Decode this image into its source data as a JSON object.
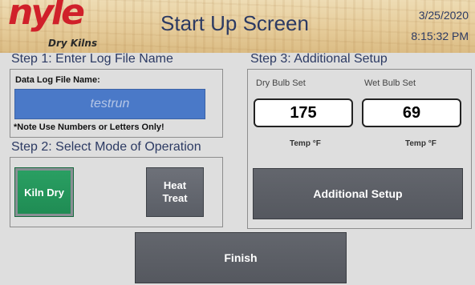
{
  "header": {
    "logo_text": "nyle",
    "logo_sub": "Dry Kilns",
    "title": "Start Up Screen",
    "date": "3/25/2020",
    "time": "8:15:32 PM",
    "brand_color": "#d0202a"
  },
  "step1": {
    "label": "Step 1:  Enter Log File Name",
    "field_label": "Data Log File Name:",
    "file_name_value": "testrun",
    "note": "*Note Use Numbers or Letters Only!"
  },
  "step2": {
    "label": "Step 2:  Select Mode of Operation",
    "kiln_dry_label": "Kiln Dry",
    "heat_treat_label": "Heat Treat",
    "selected_mode": "Kiln Dry",
    "selected_color": "#1f8b53"
  },
  "step3": {
    "label": "Step 3:  Additional Setup",
    "dry_bulb_label": "Dry Bulb Set",
    "wet_bulb_label": "Wet Bulb Set",
    "dry_bulb_value": "175",
    "wet_bulb_value": "69",
    "dry_unit": "Temp °F",
    "wet_unit": "Temp °F",
    "additional_setup_label": "Additional Setup"
  },
  "footer": {
    "finish_label": "Finish"
  }
}
